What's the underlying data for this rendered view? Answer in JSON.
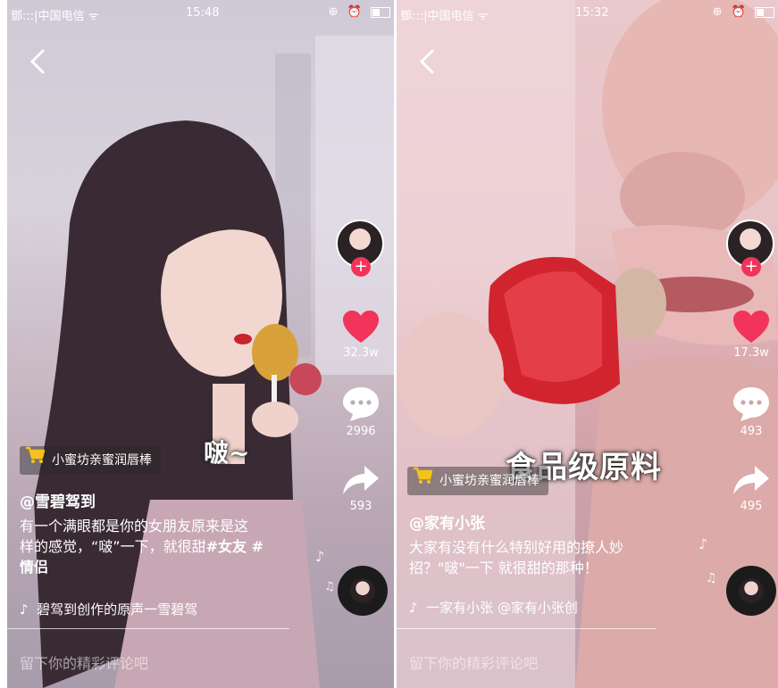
{
  "left": {
    "status": {
      "carrier": "鄧:::|中国电信 ᯤ",
      "time": "15:48",
      "icons": "⊕ ⏰"
    },
    "caption": "啵~",
    "goods_label": "小蜜坊亲蜜润唇棒",
    "author": "@雪碧驾到",
    "desc_line1": "有一个满眼都是你的女朋友原来是这",
    "desc_line2_plain": "样的感觉，“啵”一下，就很甜",
    "desc_line2_tag": "#女友 #",
    "desc_line3_tag": "情侣",
    "likes": "32.3w",
    "comments": "2996",
    "shares": "593",
    "music": "碧驾到创作的原声一雪碧驾",
    "comment_placeholder": "留下你的精彩评论吧"
  },
  "right": {
    "status": {
      "carrier": "鄧:::|中国电信 ᯤ",
      "time": "15:32",
      "icons": "⊕ ⏰"
    },
    "caption": "食品级原料",
    "goods_label": "小蜜坊亲蜜润唇棒",
    "author": "@家有小张",
    "desc_line1": "大家有没有什么特别好用的撩人妙",
    "desc_line2": "招？\"啵\"一下 就很甜的那种！",
    "likes": "17.3w",
    "comments": "493",
    "shares": "495",
    "music": "一家有小张   @家有小张创",
    "comment_placeholder": "留下你的精彩评论吧"
  },
  "colors": {
    "like": "#f2335a",
    "cart": "#f5c21b"
  },
  "icons": [
    "back-arrow-icon",
    "heart-icon",
    "comment-bubble-icon",
    "share-arrow-icon",
    "cart-icon",
    "music-note-icon",
    "record-disc-icon",
    "follow-plus-icon"
  ]
}
